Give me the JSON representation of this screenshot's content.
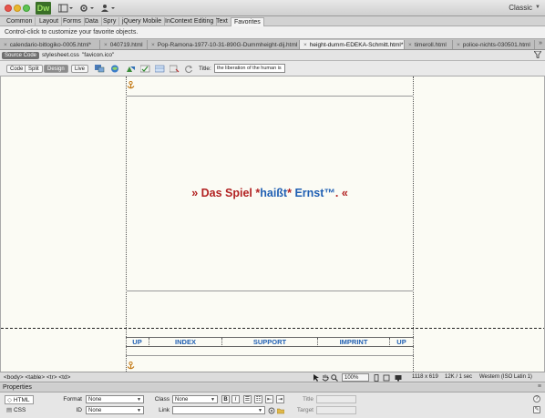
{
  "titlebar": {
    "app_logo": "Dw",
    "layout_icon": "layout-icon",
    "settings_icon": "gear-icon",
    "user_icon": "user-icon",
    "workspace": "Classic"
  },
  "insert_panel": {
    "tabs": [
      "Common",
      "Layout",
      "Forms",
      "Data",
      "Spry",
      "jQuery Mobile",
      "InContext Editing",
      "Text",
      "Favorites"
    ],
    "active_tab": "Favorites",
    "message": "Control-click to customize your favorite objects."
  },
  "document_tabs": [
    {
      "label": "calendario-bitlogiko-0005.html*",
      "active": false
    },
    {
      "label": "040719.html",
      "active": false
    },
    {
      "label": "Pop-Ramona-1977-10-31-890G-Dummheight-dij.html",
      "active": false
    },
    {
      "label": "height-dumm-EDEKA-Schmitt.html*",
      "active": true
    },
    {
      "label": "timeroll.html",
      "active": false
    },
    {
      "label": "police-nichts-030501.html",
      "active": false
    }
  ],
  "related_files": {
    "source_code": "Source Code",
    "files": [
      "stylesheet.css",
      "\"favicon.ico\""
    ]
  },
  "doc_toolbar": {
    "views": [
      "Code",
      "Split",
      "Design",
      "Live"
    ],
    "active_view": "Design",
    "title_label": "Title:",
    "title_value": "the liberation of the human is"
  },
  "design_view": {
    "headline": {
      "part1": "» Das Spiel *",
      "part2": "haißt",
      "part3": "* ",
      "part4": "Ernst™",
      "part5": ". «"
    },
    "nav": [
      "UP",
      "INDEX",
      "SUPPORT",
      "IMPRINT",
      "UP"
    ],
    "colors": {
      "headline_red": "#b22222",
      "link_blue": "#1f5fb3",
      "canvas": "#fbfbf4"
    }
  },
  "statusbar": {
    "tag_selector": "<body> <table> <tr> <td>",
    "zoom": "100%",
    "window_size": "1118 x 619",
    "download": "12K / 1 sec",
    "encoding": "Western (ISO Latin 1)"
  },
  "properties": {
    "title": "Properties",
    "modes": [
      "HTML",
      "CSS"
    ],
    "active_mode": "HTML",
    "format_label": "Format",
    "format_value": "None",
    "class_label": "Class",
    "class_value": "None",
    "id_label": "ID",
    "id_value": "None",
    "link_label": "Link",
    "link_value": "",
    "title_label": "Title",
    "target_label": "Target",
    "bold": "B",
    "italic": "I"
  }
}
